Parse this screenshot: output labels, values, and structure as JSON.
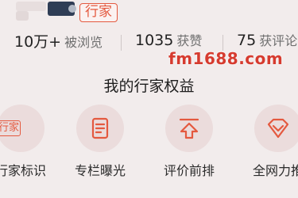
{
  "profile": {
    "badge_label": "行家"
  },
  "stats": [
    {
      "value": "10万+",
      "label": "被浏览"
    },
    {
      "value": "1035",
      "label": "获赞"
    },
    {
      "value": "75",
      "label": "获评论"
    }
  ],
  "watermark": "fm1688.com",
  "section": {
    "title": "我的行家权益"
  },
  "benefits": [
    {
      "label": "行家标识",
      "icon": "expert-badge-icon",
      "icon_text": "行家"
    },
    {
      "label": "专栏曝光",
      "icon": "column-document-icon"
    },
    {
      "label": "评价前排",
      "icon": "arrow-up-top-icon"
    },
    {
      "label": "全网力推",
      "icon": "heart-diamond-icon"
    }
  ],
  "colors": {
    "accent": "#e4593f",
    "background": "#f2ecec",
    "icon_circle": "#ebdcdc",
    "watermark": "#d63b2f"
  }
}
